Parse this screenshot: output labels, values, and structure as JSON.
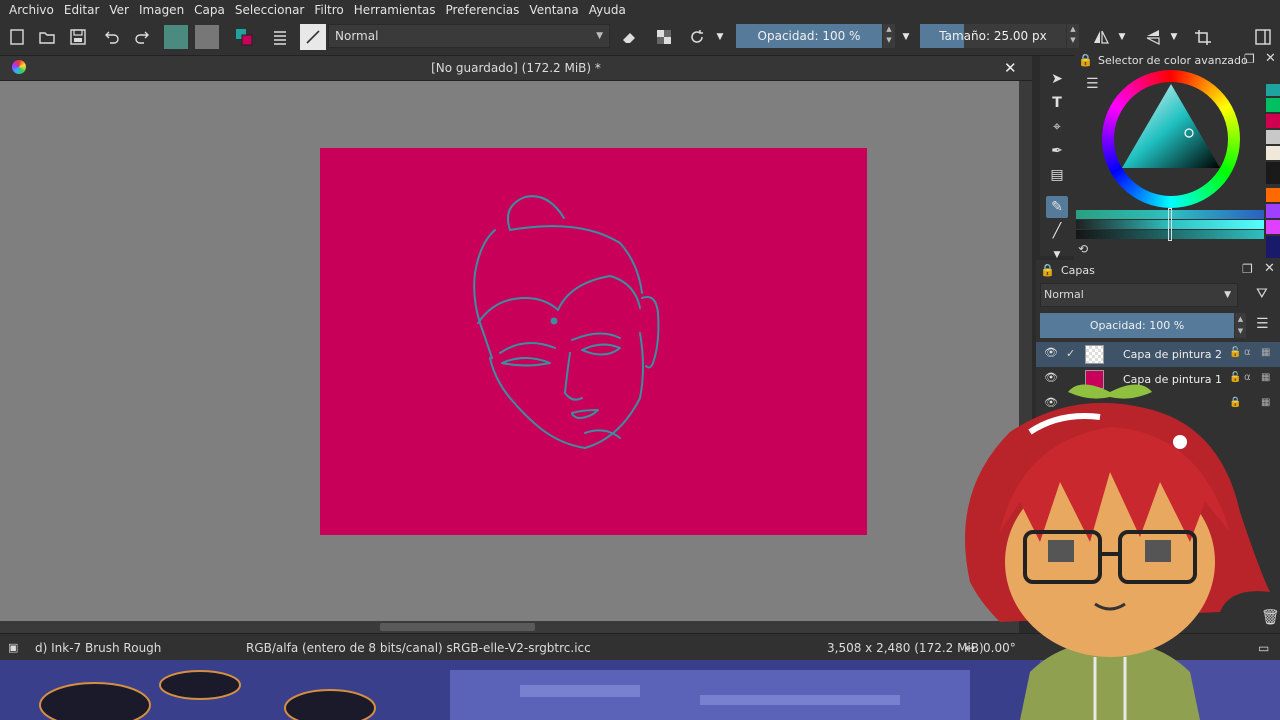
{
  "menubar": {
    "items": [
      "Archivo",
      "Editar",
      "Ver",
      "Imagen",
      "Capa",
      "Seleccionar",
      "Filtro",
      "Herramientas",
      "Preferencias",
      "Ventana",
      "Ayuda"
    ]
  },
  "toolbar": {
    "blend_mode": "Normal",
    "opacity_label": "Opacidad: 100 %",
    "size_label": "Tamaño: 25.00 px"
  },
  "document": {
    "title": "[No guardado]  (172.2 MiB) *",
    "canvas_color": "#c8005a",
    "sketch_color": "#3a8fa0"
  },
  "color_selector": {
    "title": "Selector de color avanzado",
    "swatches": [
      "#1fa3a0",
      "#00c060",
      "#d0004f",
      "#c8c8c8",
      "#f0e8d8",
      "#3a3a3a",
      "#1a1a1a",
      "#ff6a00",
      "#a040ff",
      "#e040ff",
      "#1a1a6a"
    ]
  },
  "layers": {
    "title": "Capas",
    "blend_mode": "Normal",
    "opacity_label": "Opacidad: 100 %",
    "rows": [
      {
        "name": "Capa de pintura 2",
        "thumb": "#e8e8f0"
      },
      {
        "name": "Capa de pintura 1",
        "thumb": "#c8005a"
      },
      {
        "name": "",
        "thumb": "#ffffff"
      }
    ]
  },
  "statusbar": {
    "brush": "d) Ink-7 Brush Rough",
    "color_space": "RGB/alfa (entero de 8 bits/canal)  sRGB-elle-V2-srgbtrc.icc",
    "dimensions": "3,508 x 2,480 (172.2 MiB)",
    "rotation": "0.00°"
  }
}
